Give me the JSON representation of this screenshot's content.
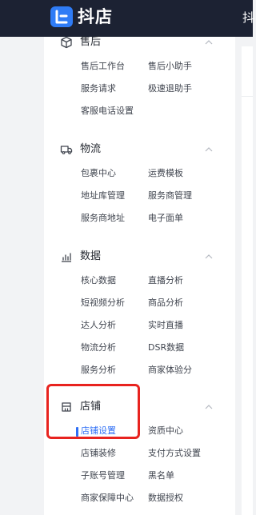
{
  "header": {
    "brand": "抖店",
    "truncated_label": "抖"
  },
  "sidebar": {
    "sections": [
      {
        "title": "售后",
        "icon": "package-box-icon",
        "items": [
          "售后工作台",
          "售后小助手",
          "服务请求",
          "极速退助手",
          "客服电话设置"
        ]
      },
      {
        "title": "物流",
        "icon": "truck-icon",
        "items": [
          "包裹中心",
          "运费模板",
          "地址库管理",
          "服务商管理",
          "服务商地址",
          "电子面单"
        ]
      },
      {
        "title": "数据",
        "icon": "chart-bars-icon",
        "items": [
          "核心数据",
          "直播分析",
          "短视频分析",
          "商品分析",
          "达人分析",
          "实时直播",
          "物流分析",
          "DSR数据",
          "服务分析",
          "商家体验分"
        ]
      },
      {
        "title": "店铺",
        "icon": "store-icon",
        "items": [
          "店铺设置",
          "资质中心",
          "店铺装修",
          "支付方式设置",
          "子账号管理",
          "黑名单",
          "商家保障中心",
          "数据授权"
        ],
        "active_item": "店铺设置"
      }
    ]
  },
  "colors": {
    "topbar_bg": "#1c2233",
    "logo_blue": "#2f7cf6",
    "active_blue": "#2f6ff5",
    "highlight_red": "#e8231f"
  }
}
